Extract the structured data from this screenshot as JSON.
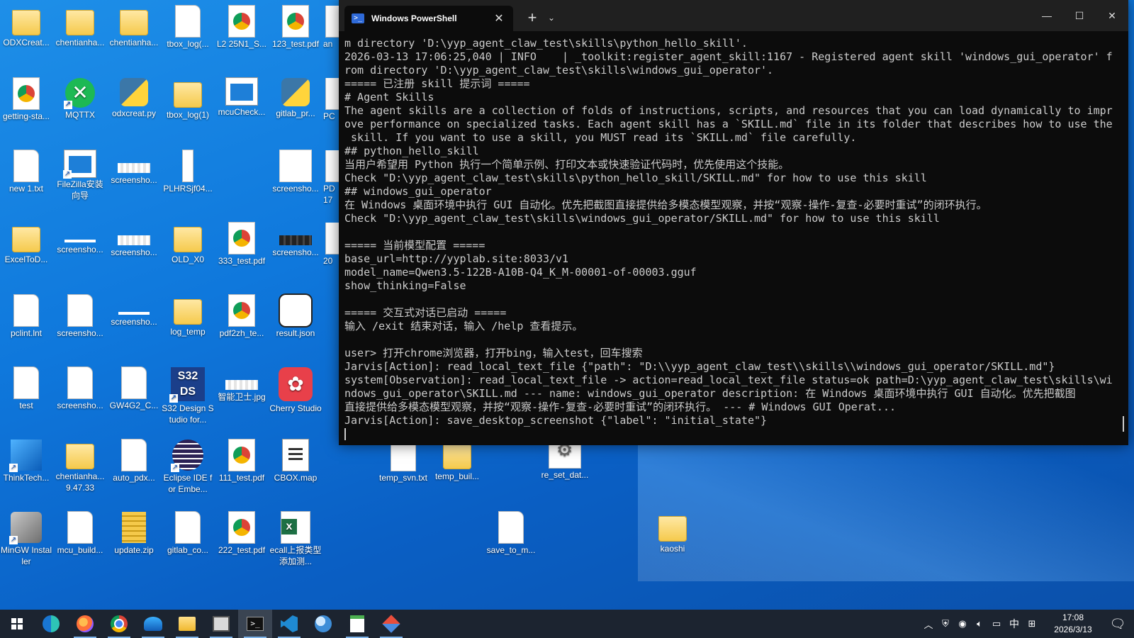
{
  "desktop": {
    "icons": [
      {
        "label": "ODXCreat...",
        "icon": "folder-icon"
      },
      {
        "label": "chentianha...",
        "icon": "folder-icon"
      },
      {
        "label": "tbox_log(...",
        "icon": "file-icon"
      },
      {
        "label": "L2 25N1_S...",
        "icon": "chrome-pdf-icon"
      },
      {
        "label": "123_test.pdf",
        "icon": "chrome-pdf-icon"
      },
      {
        "label": "getting-sta...",
        "icon": "chrome-pdf-icon"
      },
      {
        "label": "MQTTX",
        "icon": "mqttx-icon"
      },
      {
        "label": "odxcreat.py",
        "icon": "python-file-icon"
      },
      {
        "label": "tbox_log(1)",
        "icon": "folder-icon"
      },
      {
        "label": "mcuCheck...",
        "icon": "window-icon"
      },
      {
        "label": "gitlab_pr...",
        "icon": "python-file-icon"
      },
      {
        "label": "new 1.txt",
        "icon": "text-file-icon"
      },
      {
        "label": "FileZilla安装向导",
        "icon": "filezilla-icon"
      },
      {
        "label": "screensho...",
        "icon": "image-icon"
      },
      {
        "label": "PLHRSjf04...",
        "icon": "image-icon"
      },
      {
        "label": "screensho...",
        "icon": "image-icon"
      },
      {
        "label": "ExcelToD...",
        "icon": "folder-icon"
      },
      {
        "label": "screensho...",
        "icon": "image-icon"
      },
      {
        "label": "screensho...",
        "icon": "image-icon"
      },
      {
        "label": "OLD_X0",
        "icon": "folder-icon"
      },
      {
        "label": "333_test.pdf",
        "icon": "chrome-pdf-icon"
      },
      {
        "label": "screensho...",
        "icon": "image-icon"
      },
      {
        "label": "pclint.lnt",
        "icon": "file-icon"
      },
      {
        "label": "screensho...",
        "icon": "image-icon"
      },
      {
        "label": "screensho...",
        "icon": "image-icon"
      },
      {
        "label": "log_temp",
        "icon": "folder-icon"
      },
      {
        "label": "pdf2zh_te...",
        "icon": "chrome-pdf-icon"
      },
      {
        "label": "result.json",
        "icon": "json-file-icon"
      },
      {
        "label": "test",
        "icon": "file-icon"
      },
      {
        "label": "screensho...",
        "icon": "image-icon"
      },
      {
        "label": "GW4G2_C...",
        "icon": "file-icon"
      },
      {
        "label": "S32 Design Studio for...",
        "icon": "s32ds-icon"
      },
      {
        "label": "智能卫士.jpg",
        "icon": "image-icon"
      },
      {
        "label": "Cherry Studio",
        "icon": "cherry-studio-icon"
      },
      {
        "label": "ThinkTech...",
        "icon": "thinktech-icon"
      },
      {
        "label": "chentianha... 9.47.33",
        "icon": "folder-icon"
      },
      {
        "label": "auto_pdx...",
        "icon": "file-icon"
      },
      {
        "label": "Eclipse IDE for Embe...",
        "icon": "eclipse-icon"
      },
      {
        "label": "111_test.pdf",
        "icon": "chrome-pdf-icon"
      },
      {
        "label": "CBOX.map",
        "icon": "map-file-icon"
      },
      {
        "label": "MinGW Installer",
        "icon": "mingw-icon"
      },
      {
        "label": "mcu_build...",
        "icon": "text-file-icon"
      },
      {
        "label": "update.zip",
        "icon": "zip-file-icon"
      },
      {
        "label": "gitlab_co...",
        "icon": "text-file-icon"
      },
      {
        "label": "222_test.pdf",
        "icon": "chrome-pdf-icon"
      },
      {
        "label": "ecall上报类型添加测...",
        "icon": "excel-file-icon"
      },
      {
        "label": "temp_svn.txt",
        "icon": "text-file-icon"
      },
      {
        "label": "temp_buil...",
        "icon": "folder-icon"
      },
      {
        "label": "re_set_dat...",
        "icon": "settings-file-icon"
      },
      {
        "label": "save_to_m...",
        "icon": "text-file-icon"
      },
      {
        "label": "kaoshi",
        "icon": "folder-icon"
      },
      {
        "label": "an",
        "icon": "file-icon"
      },
      {
        "label": "PC",
        "icon": "file-icon"
      },
      {
        "label": "PD 17",
        "icon": "file-icon"
      },
      {
        "label": "20",
        "icon": "file-icon"
      }
    ]
  },
  "terminal": {
    "tab_title": "Windows PowerShell",
    "tab_icon": "powershell-icon",
    "lines": [
      "m directory 'D:\\yyp_agent_claw_test\\skills\\python_hello_skill'.",
      "2026-03-13 17:06:25,040 | INFO    | _toolkit:register_agent_skill:1167 - Registered agent skill 'windows_gui_operator' f",
      "rom directory 'D:\\yyp_agent_claw_test\\skills\\windows_gui_operator'.",
      "===== 已注册 skill 提示词 =====",
      "# Agent Skills",
      "The agent skills are a collection of folds of instructions, scripts, and resources that you can load dynamically to impr",
      "ove performance on specialized tasks. Each agent skill has a `SKILL.md` file in its folder that describes how to use the",
      " skill. If you want to use a skill, you MUST read its `SKILL.md` file carefully.",
      "## python_hello_skill",
      "当用户希望用 Python 执行一个简单示例、打印文本或快速验证代码时，优先使用这个技能。",
      "Check \"D:\\yyp_agent_claw_test\\skills\\python_hello_skill/SKILL.md\" for how to use this skill",
      "## windows_gui_operator",
      "在 Windows 桌面环境中执行 GUI 自动化。优先把截图直接提供给多模态模型观察，并按“观察-操作-复查-必要时重试”的闭环执行。",
      "Check \"D:\\yyp_agent_claw_test\\skills\\windows_gui_operator/SKILL.md\" for how to use this skill",
      "",
      "===== 当前模型配置 =====",
      "base_url=http://yyplab.site:8033/v1",
      "model_name=Qwen3.5-122B-A10B-Q4_K_M-00001-of-00003.gguf",
      "show_thinking=False",
      "",
      "===== 交互式对话已启动 =====",
      "输入 /exit 结束对话，输入 /help 查看提示。",
      "",
      "user> 打开chrome浏览器，打开bing，输入test，回车搜索",
      "Jarvis[Action]: read_local_text_file {\"path\": \"D:\\\\yyp_agent_claw_test\\\\skills\\\\windows_gui_operator/SKILL.md\"}",
      "system[Observation]: read_local_text_file -> action=read_local_text_file status=ok path=D:\\yyp_agent_claw_test\\skills\\wi",
      "ndows_gui_operator\\SKILL.md --- name: windows_gui_operator description: 在 Windows 桌面环境中执行 GUI 自动化。优先把截图",
      "直接提供给多模态模型观察，并按“观察-操作-复查-必要时重试”的闭环执行。 --- # Windows GUI Operat...",
      "Jarvis[Action]: save_desktop_screenshot {\"label\": \"initial_state\"}"
    ]
  },
  "taskbar": {
    "apps": [
      {
        "name": "start",
        "icon": "windows-start-icon"
      },
      {
        "name": "edge",
        "icon": "edge-icon"
      },
      {
        "name": "firefox",
        "icon": "firefox-icon"
      },
      {
        "name": "chrome",
        "icon": "chrome-icon"
      },
      {
        "name": "wave",
        "icon": "wave-app-icon"
      },
      {
        "name": "explorer",
        "icon": "file-explorer-icon"
      },
      {
        "name": "snipping",
        "icon": "snipping-tool-icon"
      },
      {
        "name": "terminal",
        "icon": "terminal-icon"
      },
      {
        "name": "vscode",
        "icon": "vscode-icon"
      },
      {
        "name": "globe",
        "icon": "browser-globe-icon"
      },
      {
        "name": "notepad",
        "icon": "notepad-icon"
      },
      {
        "name": "git",
        "icon": "git-diamond-icon"
      }
    ],
    "tray": {
      "ime": "中",
      "time": "17:08",
      "date": "2026/3/13"
    }
  }
}
